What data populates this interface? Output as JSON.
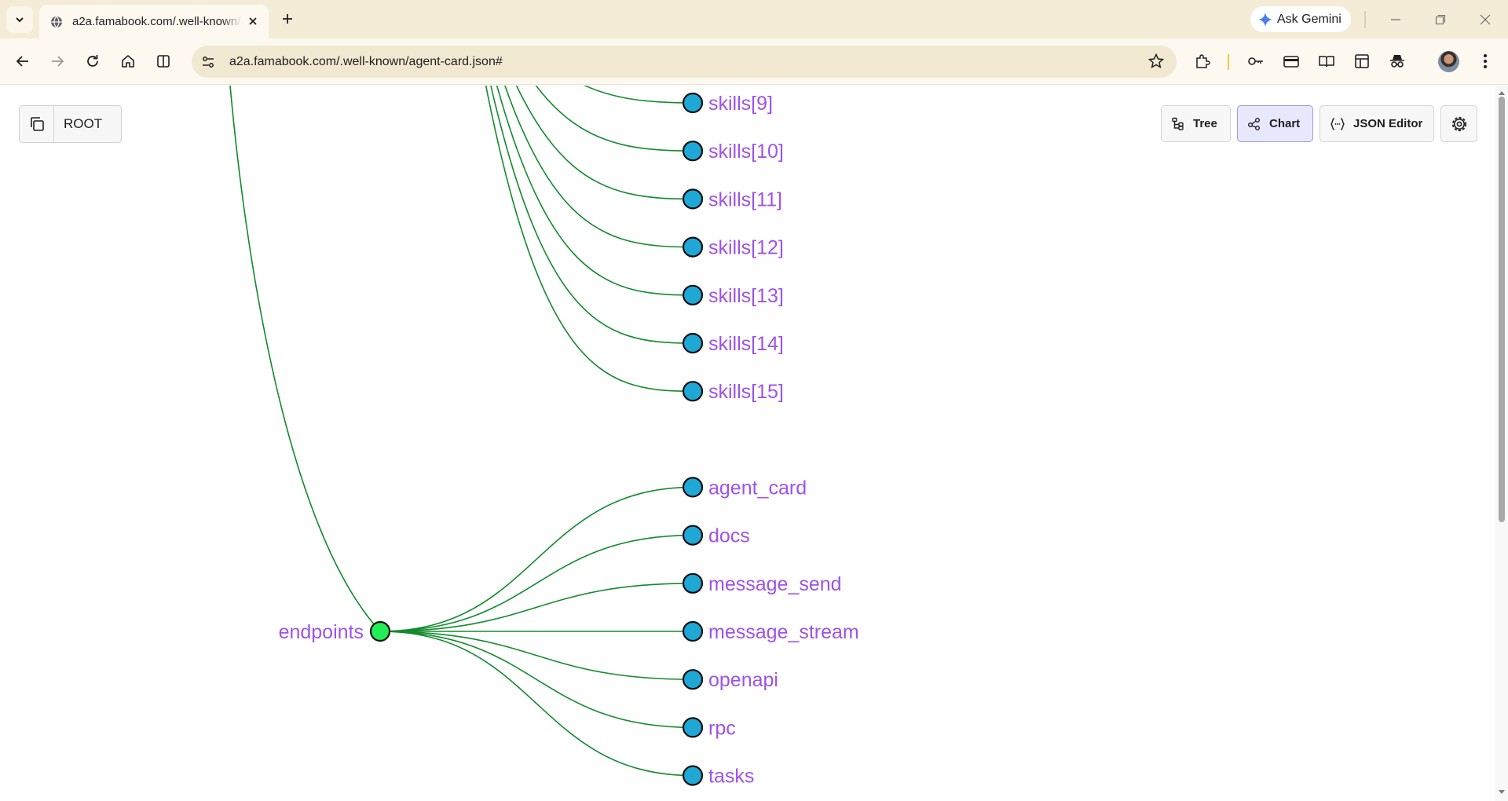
{
  "browser": {
    "tab_title": "a2a.famabook.com/.well-known/agent-card.json",
    "url": "a2a.famabook.com/.well-known/agent-card.json#",
    "ask_gemini_label": "Ask Gemini"
  },
  "app": {
    "root_label": "ROOT",
    "views": [
      {
        "label": "Tree",
        "icon": "tree-icon",
        "active": false
      },
      {
        "label": "Chart",
        "icon": "chart-icon",
        "active": true
      },
      {
        "label": "JSON Editor",
        "icon": "braces-icon",
        "active": false
      }
    ]
  },
  "graph": {
    "node_color": "#1fa8d6",
    "parent_node_color": "#22ee55",
    "edge_color": "#138a2e",
    "label_color": "#a052e6",
    "skills_nodes": [
      "skills[9]",
      "skills[10]",
      "skills[11]",
      "skills[12]",
      "skills[13]",
      "skills[14]",
      "skills[15]"
    ],
    "endpoints_node": "endpoints",
    "endpoints_children": [
      "agent_card",
      "docs",
      "message_send",
      "message_stream",
      "openapi",
      "rpc",
      "tasks"
    ]
  }
}
